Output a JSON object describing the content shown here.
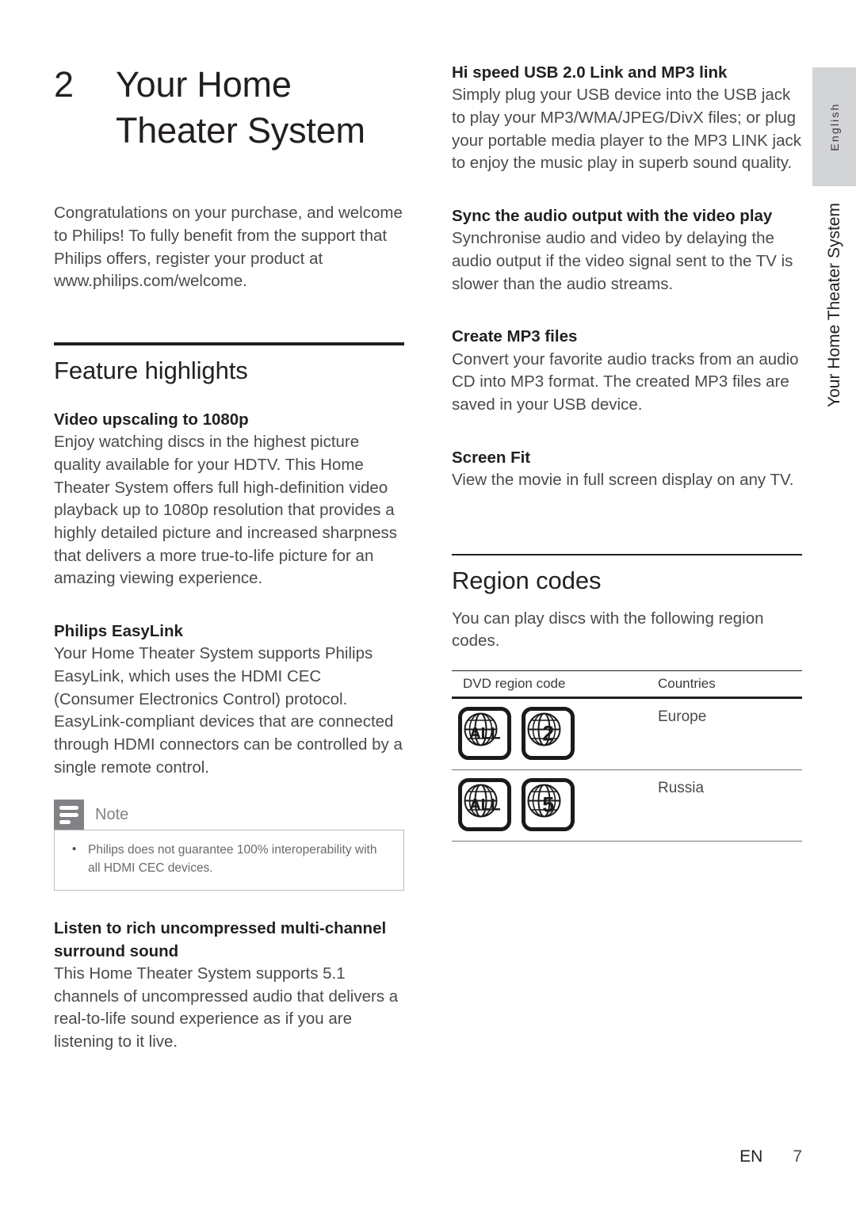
{
  "chapter": {
    "number": "2",
    "title_line1": "Your Home",
    "title_line2": "Theater System"
  },
  "intro": {
    "paragraph": "Congratulations on your purchase, and welcome to Philips! To fully benefit from the support that Philips offers, register your product at www.philips.com/welcome."
  },
  "feature_highlights": {
    "title": "Feature highlights",
    "blocks": [
      {
        "heading": "Video upscaling to 1080p",
        "body": "Enjoy watching discs in the highest picture quality available for your HDTV. This Home Theater System offers full high-definition video playback up to 1080p resolution that provides a highly detailed picture and increased sharpness that delivers a more true-to-life picture for an amazing viewing experience."
      },
      {
        "heading": "Philips EasyLink",
        "body": "Your Home Theater System supports Philips EasyLink, which uses the HDMI CEC (Consumer Electronics Control) protocol. EasyLink-compliant devices that are connected through HDMI connectors can be controlled by a single remote control."
      },
      {
        "heading": "Listen to rich uncompressed multi-channel surround sound",
        "body": "This Home Theater System supports 5.1 channels of uncompressed audio that delivers a real-to-life sound experience as if you are listening to it live."
      }
    ]
  },
  "note": {
    "label": "Note",
    "items": [
      "Philips does not guarantee 100% interoperability with all HDMI CEC devices."
    ]
  },
  "right_column_blocks": [
    {
      "heading": "Hi speed USB 2.0 Link and MP3 link",
      "body": "Simply plug your USB device into the USB jack to play your MP3/WMA/JPEG/DivX files; or plug your portable media player to the MP3 LINK jack to enjoy the music play in superb sound quality."
    },
    {
      "heading": "Sync the audio output with the video play",
      "body": "Synchronise audio and video by delaying the audio output if the video signal sent to the TV is slower than the audio streams."
    },
    {
      "heading": "Create MP3 files",
      "body": "Convert your favorite audio tracks from an audio CD into MP3 format. The created MP3 files are saved in your USB device."
    },
    {
      "heading": "Screen Fit",
      "body": "View the movie in full screen display on any TV."
    }
  ],
  "region_codes": {
    "title": "Region codes",
    "intro": "You can play discs with the following region codes.",
    "columns": [
      "DVD region code",
      "Countries"
    ],
    "rows": [
      {
        "codes": [
          "ALL",
          "2"
        ],
        "country": "Europe"
      },
      {
        "codes": [
          "ALL",
          "5"
        ],
        "country": "Russia"
      }
    ]
  },
  "margin": {
    "language_tab": "English",
    "running_title": "Your Home Theater System"
  },
  "footer": {
    "language_code": "EN",
    "page_number": "7"
  },
  "colors": {
    "tab_gray": "#d3d4d6",
    "note_icon_gray": "#808285",
    "heading_black": "#231f20",
    "body_gray": "#4a4a4c"
  }
}
